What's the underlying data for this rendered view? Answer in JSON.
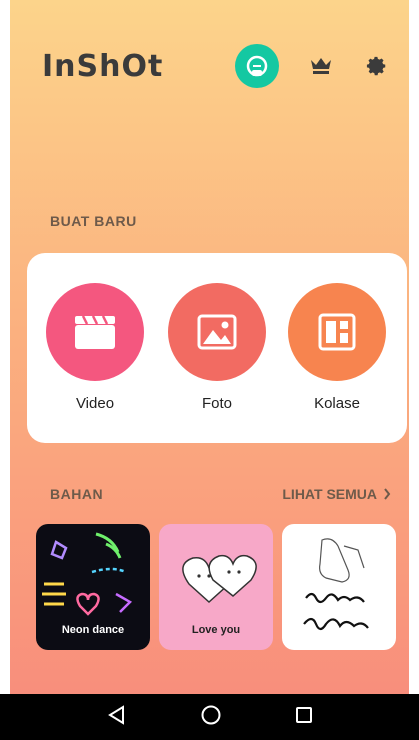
{
  "app": {
    "logo": "InShOt"
  },
  "sections": {
    "create_title": "BUAT BARU",
    "materials_title": "BAHAN",
    "see_all": "LIHAT SEMUA"
  },
  "create_items": [
    {
      "label": "Video",
      "color": "#f4577f",
      "icon": "clapperboard-icon"
    },
    {
      "label": "Foto",
      "color": "#f26b62",
      "icon": "image-icon"
    },
    {
      "label": "Kolase",
      "color": "#f7844f",
      "icon": "collage-icon"
    }
  ],
  "materials": [
    {
      "label": "Neon dance"
    },
    {
      "label": "Love you"
    },
    {
      "label": ""
    }
  ],
  "colors": {
    "ad_button": "#14c8a2",
    "bg_top": "#fcd48b",
    "bg_bottom": "#f88a7b"
  },
  "nav": [
    "back-icon",
    "home-icon",
    "recents-icon"
  ]
}
